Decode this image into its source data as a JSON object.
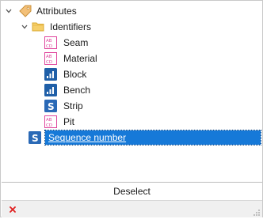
{
  "tree": {
    "root": {
      "label": "Attributes",
      "icon": "tag-icon",
      "expanded": true
    },
    "group": {
      "label": "Identifiers",
      "icon": "folder-icon",
      "expanded": true
    },
    "items": [
      {
        "label": "Seam",
        "icon": "text-field-icon"
      },
      {
        "label": "Material",
        "icon": "text-field-icon"
      },
      {
        "label": "Block",
        "icon": "numeric-field-icon"
      },
      {
        "label": "Bench",
        "icon": "numeric-field-icon"
      },
      {
        "label": "Strip",
        "icon": "sequence-field-icon"
      },
      {
        "label": "Pit",
        "icon": "text-field-icon"
      }
    ],
    "selected": {
      "label": "Sequence number",
      "icon": "sequence-field-icon"
    }
  },
  "footer": {
    "deselect_label": "Deselect"
  },
  "colors": {
    "selection": "#1679d8",
    "text_icon": "#e0479e",
    "numeric_icon": "#1f5fa8",
    "sequence_icon": "#2a69b6",
    "close": "#e02020"
  }
}
